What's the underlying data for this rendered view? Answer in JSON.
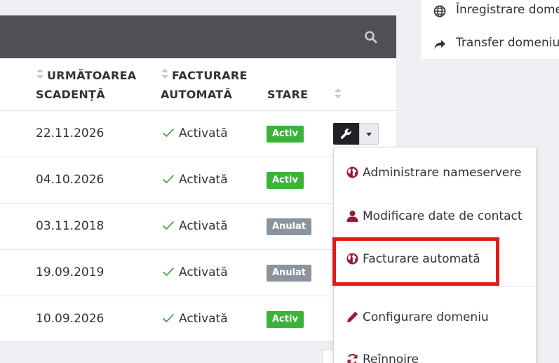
{
  "sidebar": {
    "items": [
      {
        "label": "Înregistrare domeniu",
        "icon": "globe-icon"
      },
      {
        "label": "Transfer domeniu",
        "icon": "share-arrow-icon"
      }
    ]
  },
  "table": {
    "search_icon": "search-icon",
    "headers": {
      "next_due_line1": "URMĂTOAREA",
      "next_due_line2": "SCADENȚĂ",
      "autobill_line1": "FACTURARE",
      "autobill_line2": "AUTOMATĂ",
      "status": "STARE"
    },
    "rows": [
      {
        "date": "22.11.2026",
        "autobill": "Activată",
        "status": "Activ",
        "status_type": "active"
      },
      {
        "date": "04.10.2026",
        "autobill": "Activată",
        "status": "Activ",
        "status_type": "active"
      },
      {
        "date": "03.11.2018",
        "autobill": "Activată",
        "status": "Anulat",
        "status_type": "cancelled"
      },
      {
        "date": "19.09.2019",
        "autobill": "Activată",
        "status": "Anulat",
        "status_type": "cancelled"
      },
      {
        "date": "10.09.2026",
        "autobill": "Activată",
        "status": "Activ",
        "status_type": "active"
      }
    ]
  },
  "dropdown": {
    "items": [
      {
        "label": "Administrare nameservere",
        "icon": "globe-icon"
      },
      {
        "label": "Modificare date de contact",
        "icon": "user-icon"
      },
      {
        "label": "Facturare automată",
        "icon": "globe-icon"
      },
      {
        "label": "Configurare domeniu",
        "icon": "pencil-icon"
      },
      {
        "label": "Reînnoire",
        "icon": "refresh-icon"
      }
    ]
  },
  "colors": {
    "header_bar": "#4e5055",
    "active": "#3bb33b",
    "cancelled": "#8b949d",
    "icon_accent": "#9b1b30",
    "highlight": "#e11b1b"
  }
}
